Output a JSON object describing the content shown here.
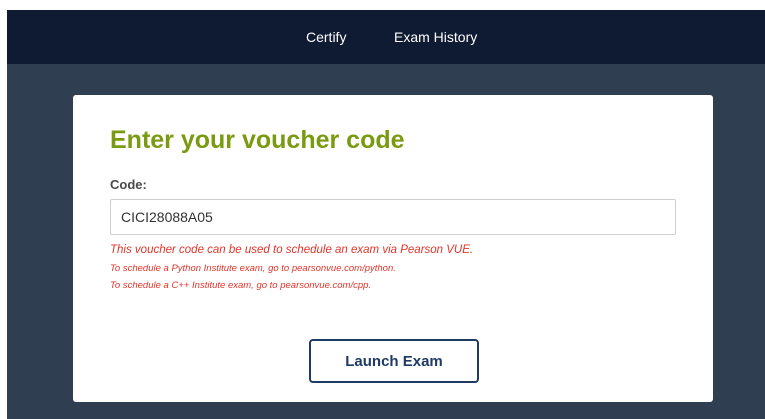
{
  "nav": {
    "items": [
      {
        "label": "Certify"
      },
      {
        "label": "Exam History"
      }
    ]
  },
  "voucher": {
    "title": "Enter your voucher code",
    "code_label": "Code:",
    "code_value": "CICI28088A05",
    "messages": {
      "main": "This voucher code can be used to schedule an exam via Pearson VUE.",
      "python": "To schedule a Python Institute exam, go to pearsonvue.com/python.",
      "cpp": "To schedule a C++ Institute exam, go to pearsonvue.com/cpp."
    },
    "launch_label": "Launch Exam"
  },
  "colors": {
    "nav_background": "#0f1b33",
    "page_background": "#2f3e50",
    "title_green": "#7a9a12",
    "message_red": "#e0352a",
    "button_navy": "#1f3a63"
  }
}
